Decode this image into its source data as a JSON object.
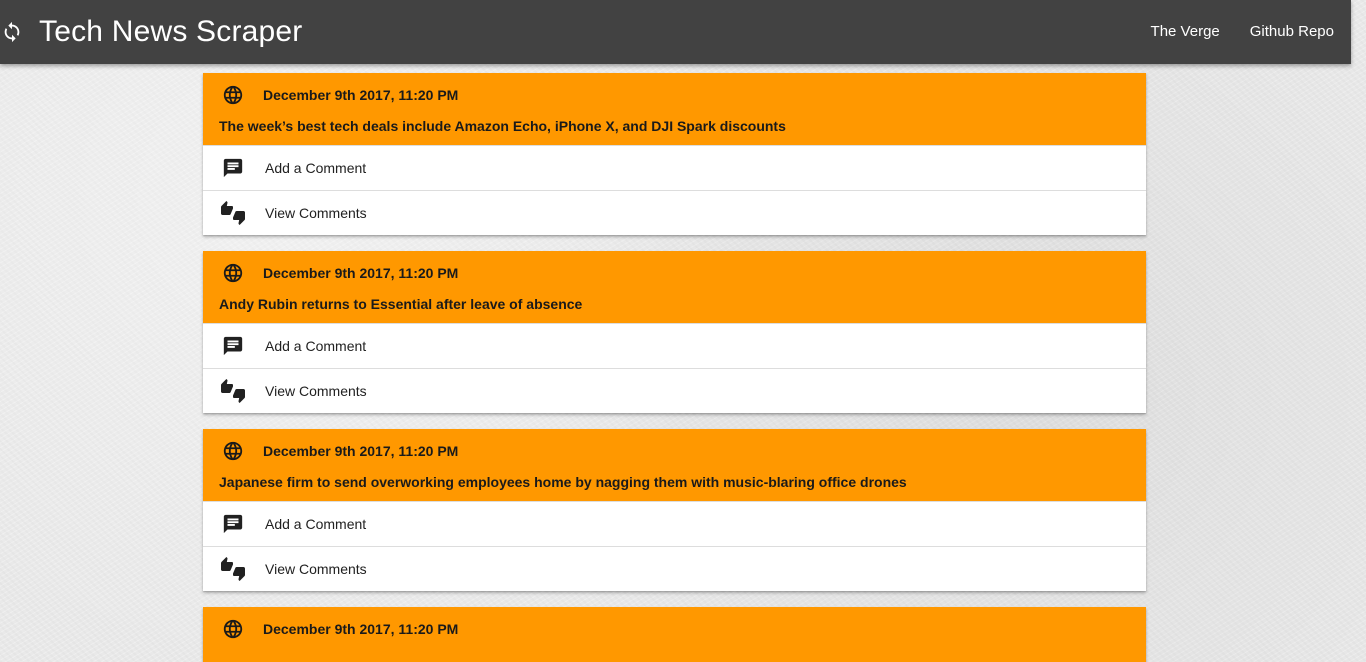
{
  "app": {
    "title": "Tech News Scraper",
    "brand_icon": "refresh-icon"
  },
  "nav": {
    "links": [
      {
        "label": "The Verge"
      },
      {
        "label": "Github Repo"
      }
    ]
  },
  "colors": {
    "navbar": "#424242",
    "card_header": "#ff9800",
    "background": "#e9e9e9"
  },
  "articles": [
    {
      "date": "December 9th 2017, 11:20 PM",
      "title": "The week’s best tech deals include Amazon Echo, iPhone X, and DJI Spark discounts",
      "add_comment": "Add a Comment",
      "view_comments": "View Comments"
    },
    {
      "date": "December 9th 2017, 11:20 PM",
      "title": "Andy Rubin returns to Essential after leave of absence",
      "add_comment": "Add a Comment",
      "view_comments": "View Comments"
    },
    {
      "date": "December 9th 2017, 11:20 PM",
      "title": "Japanese firm to send overworking employees home by nagging them with music-blaring office drones",
      "add_comment": "Add a Comment",
      "view_comments": "View Comments"
    },
    {
      "date": "December 9th 2017, 11:20 PM",
      "title": "",
      "add_comment": "",
      "view_comments": ""
    }
  ]
}
